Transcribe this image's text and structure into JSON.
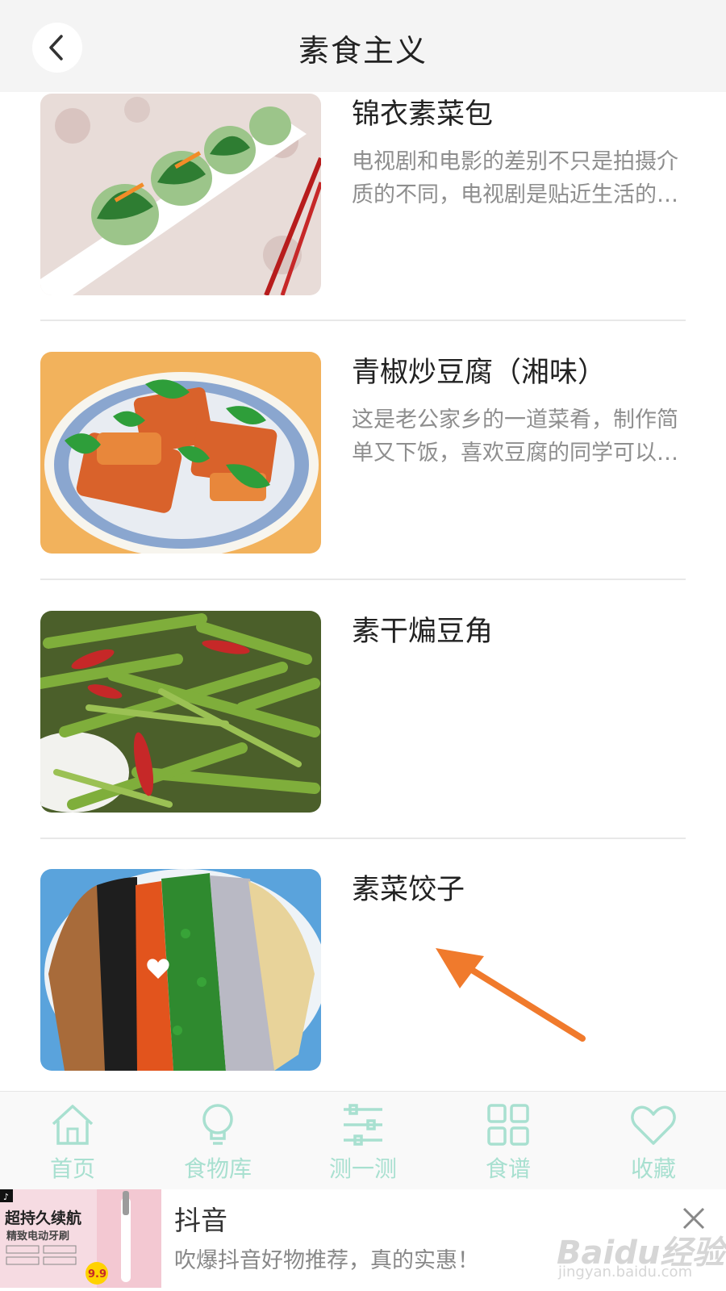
{
  "header": {
    "title": "素食主义",
    "back_icon": "chevron-left-icon"
  },
  "items": [
    {
      "title": "锦衣素菜包",
      "desc": "电视剧和电影的差别不只是拍摄介质的不同，电视剧是贴近生活的艺术形式"
    },
    {
      "title": "青椒炒豆腐（湘味）",
      "desc": "这是老公家乡的一道菜肴，制作简单又下饭，喜欢豆腐的同学可以试试"
    },
    {
      "title": "素干煸豆角",
      "desc": ""
    },
    {
      "title": "素菜饺子",
      "desc": ""
    }
  ],
  "tabbar": {
    "tabs": [
      {
        "label": "首页",
        "icon": "home-icon"
      },
      {
        "label": "食物库",
        "icon": "lightbulb-icon"
      },
      {
        "label": "测一测",
        "icon": "sliders-icon"
      },
      {
        "label": "食谱",
        "icon": "grid-icon"
      },
      {
        "label": "收藏",
        "icon": "heart-icon"
      }
    ],
    "color": "#a8e0d0"
  },
  "ad": {
    "title": "抖音",
    "desc": "吹爆抖音好物推荐，真的实惠！",
    "image_text": {
      "headline": "超持久续航",
      "subline": "精致电动牙刷",
      "price": "9.9"
    },
    "watermark": "Baidu经验",
    "watermark_sub": "jingyan.baidu.com"
  },
  "accent": "#f07a2c"
}
